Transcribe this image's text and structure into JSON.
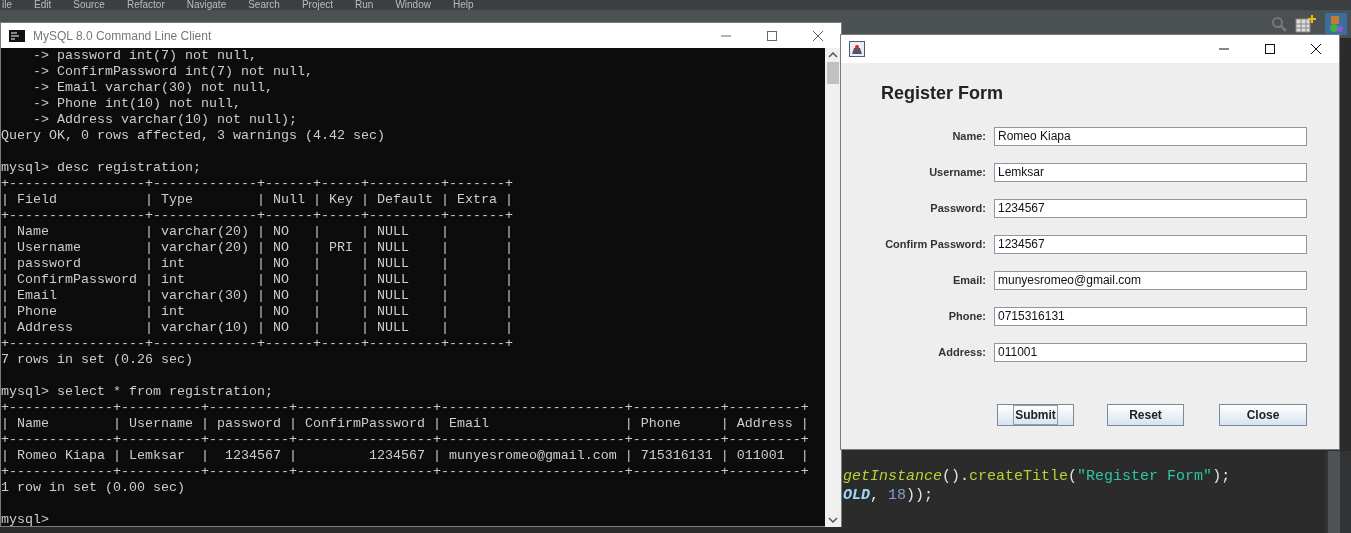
{
  "ide": {
    "menu": [
      "ile",
      "Edit",
      "Source",
      "Refactor",
      "Navigate",
      "Search",
      "Project",
      "Run",
      "Window",
      "Help"
    ],
    "code_lines": [
      [
        {
          "text": "getInstance",
          "kind": "static-method"
        },
        {
          "text": "().",
          "kind": "punct"
        },
        {
          "text": "createTitle",
          "kind": "method"
        },
        {
          "text": "(",
          "kind": "punct"
        },
        {
          "text": "\"Register Form\"",
          "kind": "string"
        },
        {
          "text": ");",
          "kind": "punct"
        }
      ],
      [
        {
          "text": "OLD",
          "kind": "constant"
        },
        {
          "text": ", ",
          "kind": "punct"
        },
        {
          "text": "18",
          "kind": "number"
        },
        {
          "text": "));",
          "kind": "punct"
        }
      ]
    ]
  },
  "terminal": {
    "title": "MySQL 8.0 Command Line Client",
    "blocks": [
      [
        "    -> password int(7) not null,",
        "    -> ConfirmPassword int(7) not null,",
        "    -> Email varchar(30) not null,",
        "    -> Phone int(10) not null,",
        "    -> Address varchar(10) not null);",
        "Query OK, 0 rows affected, 3 warnings (4.42 sec)"
      ],
      [
        "mysql> desc registration;",
        "+-----------------+-------------+------+-----+---------+-------+",
        "| Field           | Type        | Null | Key | Default | Extra |",
        "+-----------------+-------------+------+-----+---------+-------+",
        "| Name            | varchar(20) | NO   |     | NULL    |       |",
        "| Username        | varchar(20) | NO   | PRI | NULL    |       |",
        "| password        | int         | NO   |     | NULL    |       |",
        "| ConfirmPassword | int         | NO   |     | NULL    |       |",
        "| Email           | varchar(30) | NO   |     | NULL    |       |",
        "| Phone           | int         | NO   |     | NULL    |       |",
        "| Address         | varchar(10) | NO   |     | NULL    |       |",
        "+-----------------+-------------+------+-----+---------+-------+",
        "7 rows in set (0.26 sec)"
      ],
      [
        "mysql> select * from registration;",
        "+-------------+----------+----------+-----------------+-----------------------+-----------+---------+",
        "| Name        | Username | password | ConfirmPassword | Email                 | Phone     | Address |",
        "+-------------+----------+----------+-----------------+-----------------------+-----------+---------+",
        "| Romeo Kiapa | Lemksar  |  1234567 |         1234567 | munyesromeo@gmail.com | 715316131 | 011001  |",
        "+-------------+----------+----------+-----------------+-----------------------+-----------+---------+",
        "1 row in set (0.00 sec)"
      ],
      [
        "mysql>"
      ]
    ]
  },
  "register": {
    "heading": "Register Form",
    "fields": [
      {
        "label": "Name:",
        "value": "Romeo Kiapa"
      },
      {
        "label": "Username:",
        "value": "Lemksar"
      },
      {
        "label": "Password:",
        "value": "1234567"
      },
      {
        "label": "Confirm Password:",
        "value": "1234567"
      },
      {
        "label": "Email:",
        "value": "munyesromeo@gmail.com"
      },
      {
        "label": "Phone:",
        "value": "0715316131"
      },
      {
        "label": "Address:",
        "value": "011001"
      }
    ],
    "buttons": [
      {
        "label": "Submit",
        "focused": true
      },
      {
        "label": "Reset",
        "focused": false
      },
      {
        "label": "Close",
        "focused": false
      }
    ]
  }
}
